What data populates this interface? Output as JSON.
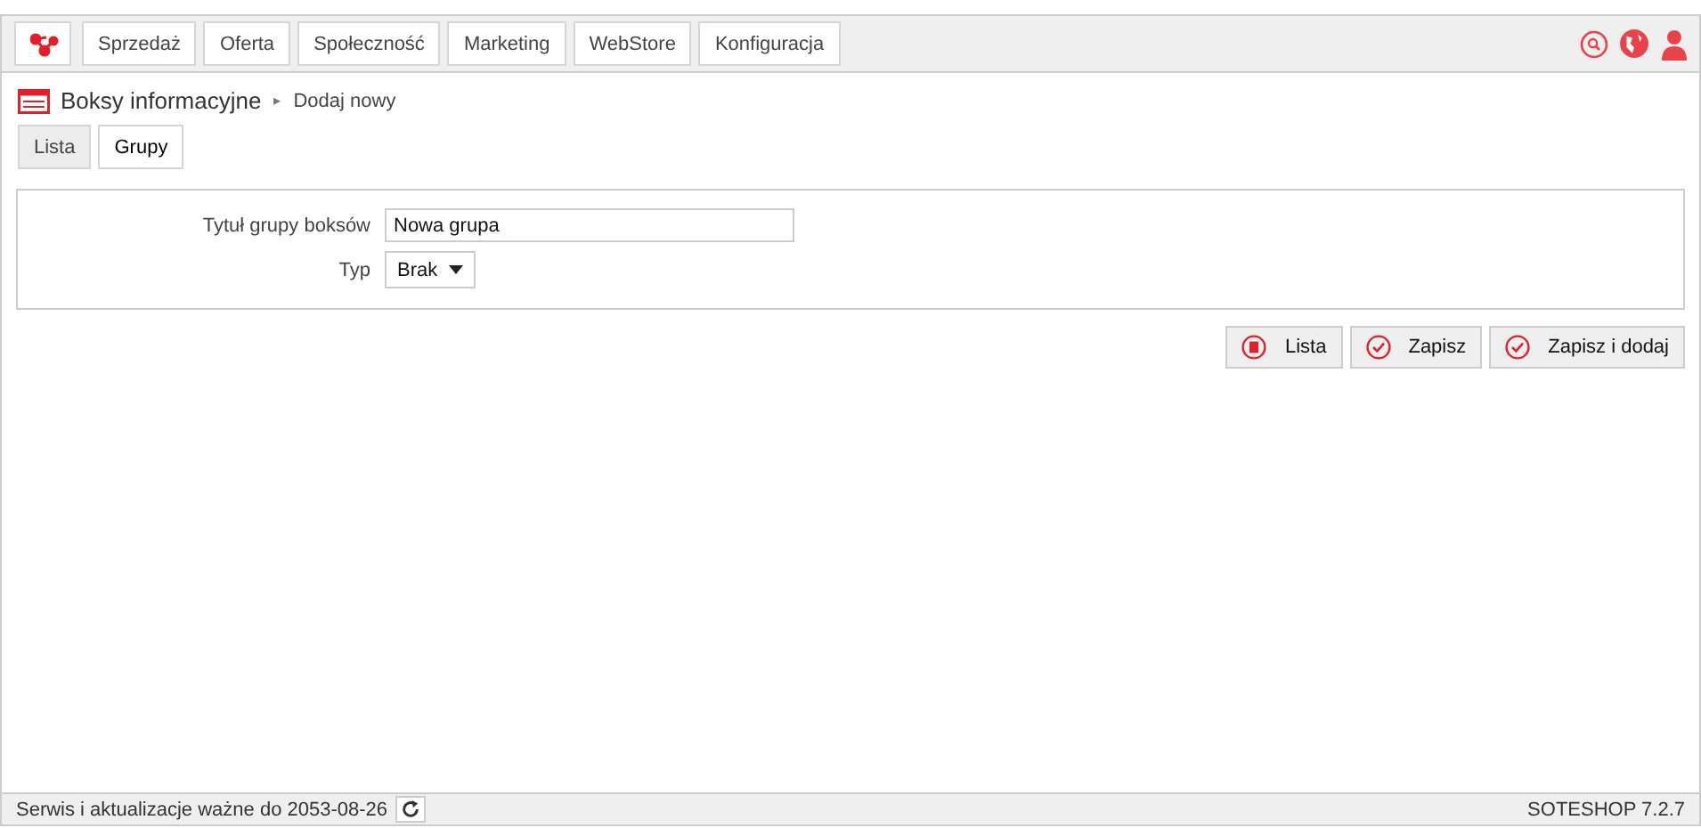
{
  "nav": {
    "items": [
      {
        "label": "Sprzedaż"
      },
      {
        "label": "Oferta"
      },
      {
        "label": "Społeczność"
      },
      {
        "label": "Marketing"
      },
      {
        "label": "WebStore"
      },
      {
        "label": "Konfiguracja"
      }
    ]
  },
  "breadcrumb": {
    "title": "Boksy informacyjne",
    "separator": "▸",
    "current": "Dodaj nowy"
  },
  "tabs": [
    {
      "label": "Lista",
      "selected": false
    },
    {
      "label": "Grupy",
      "selected": true
    }
  ],
  "form": {
    "fields": [
      {
        "kind": "text",
        "label": "Tytuł grupy boksów",
        "value": "Nowa grupa"
      },
      {
        "kind": "select",
        "label": "Typ",
        "value": "Brak"
      }
    ]
  },
  "actions": [
    {
      "kind": "list",
      "label": "Lista"
    },
    {
      "kind": "save",
      "label": "Zapisz"
    },
    {
      "kind": "save",
      "label": "Zapisz i dodaj"
    }
  ],
  "status_bar": {
    "left": "Serwis i aktualizacje ważne do 2053-08-26",
    "right": "SOTESHOP 7.2.7"
  }
}
